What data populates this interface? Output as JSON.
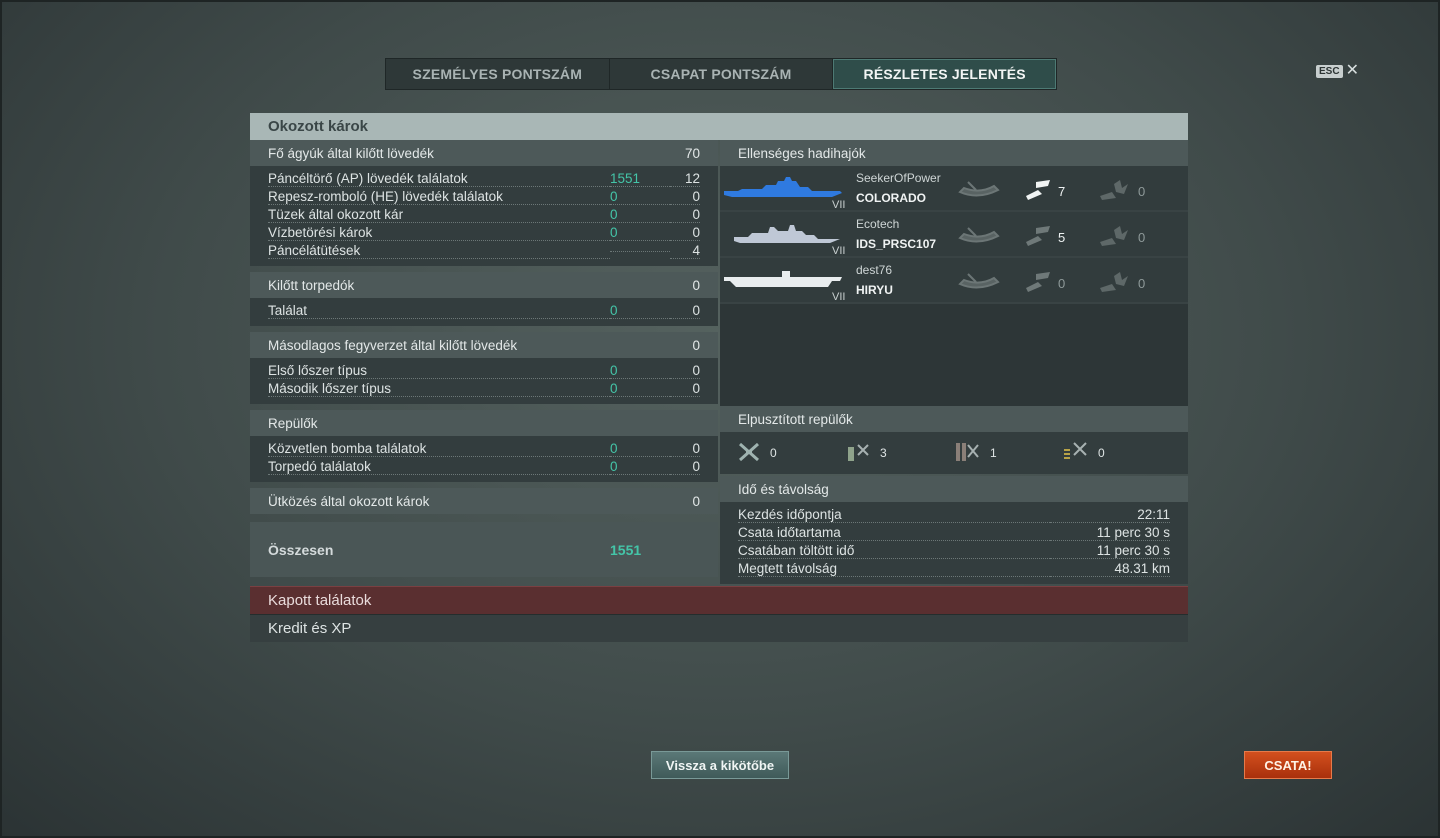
{
  "tabs": [
    "SZEMÉLYES PONTSZÁM",
    "CSAPAT PONTSZÁM",
    "RÉSZLETES JELENTÉS"
  ],
  "esc_label": "ESC",
  "panel_title": "Okozott károk",
  "main_guns": {
    "title": "Fő ágyúk által kilőtt lövedék",
    "total": "70",
    "rows": [
      {
        "label": "Páncéltörő (AP) lövedék találatok",
        "dmg": "1551",
        "count": "12"
      },
      {
        "label": "Repesz-romboló (HE) lövedék találatok",
        "dmg": "0",
        "count": "0"
      },
      {
        "label": "Tüzek által okozott kár",
        "dmg": "0",
        "count": "0"
      },
      {
        "label": "Vízbetörési károk",
        "dmg": "0",
        "count": "0"
      },
      {
        "label": "Páncélátütések",
        "dmg": "",
        "count": "4"
      }
    ]
  },
  "torpedoes": {
    "title": "Kilőtt torpedók",
    "total": "0",
    "rows": [
      {
        "label": "Találat",
        "dmg": "0",
        "count": "0"
      }
    ]
  },
  "secondary": {
    "title": "Másodlagos fegyverzet által kilőtt lövedék",
    "total": "0",
    "rows": [
      {
        "label": "Első lőszer típus",
        "dmg": "0",
        "count": "0"
      },
      {
        "label": "Második lőszer típus",
        "dmg": "0",
        "count": "0"
      }
    ]
  },
  "aircraft": {
    "title": "Repülők",
    "rows": [
      {
        "label": "Közvetlen bomba találatok",
        "dmg": "0",
        "count": "0"
      },
      {
        "label": "Torpedó találatok",
        "dmg": "0",
        "count": "0"
      }
    ]
  },
  "ramming": {
    "title": "Ütközés által okozott károk",
    "total": "0"
  },
  "total": {
    "label": "Összesen",
    "value": "1551"
  },
  "enemy_ships": {
    "title": "Ellenséges hadihajók",
    "ships": [
      {
        "player": "SeekerOfPower",
        "ship": "COLORADO",
        "tier": "VII",
        "color": "#2f7ae0",
        "torp": "",
        "shells": "7",
        "fire": "0"
      },
      {
        "player": "Ecotech",
        "ship": "IDS_PRSC107",
        "tier": "VII",
        "color": "#bfc8d6",
        "torp": "",
        "shells": "5",
        "fire": "0"
      },
      {
        "player": "dest76",
        "ship": "HIRYU",
        "tier": "VII",
        "color": "#e9edef",
        "torp": "",
        "shells": "0",
        "fire": "0"
      }
    ]
  },
  "planes_destroyed": {
    "title": "Elpusztított repülők",
    "items": [
      {
        "icon": "fighter-icon",
        "value": "0"
      },
      {
        "icon": "torpedo-bomber-icon",
        "value": "3"
      },
      {
        "icon": "dive-bomber-icon",
        "value": "1"
      },
      {
        "icon": "scout-plane-icon",
        "value": "0"
      }
    ]
  },
  "time": {
    "title": "Idő és távolság",
    "rows": [
      {
        "label": "Kezdés időpontja",
        "value": "22:11"
      },
      {
        "label": "Csata időtartama",
        "value": "11 perc 30 s"
      },
      {
        "label": "Csatában töltött idő",
        "value": "11 perc 30 s"
      },
      {
        "label": "Megtett távolság",
        "value": "48.31 km"
      }
    ]
  },
  "received_hits": "Kapott találatok",
  "credits_xp": "Kredit és XP",
  "back_button": "Vissza a kikötőbe",
  "battle_button": "CSATA!",
  "colors": {
    "accent_value": "#44c5a8",
    "battle": "#c24417",
    "active_tab": "#2f4d4a"
  }
}
